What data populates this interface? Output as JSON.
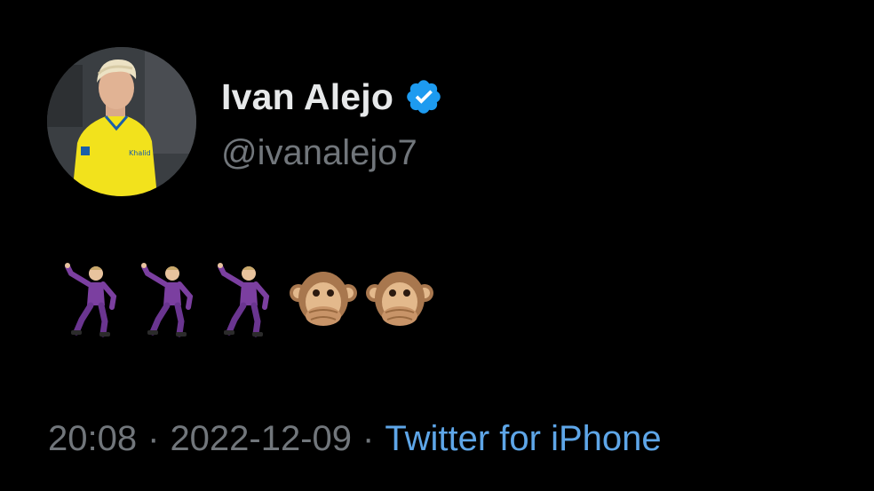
{
  "author": {
    "display_name": "Ivan Alejo",
    "handle": "@ivanalejo7",
    "verified_icon": "verified-badge",
    "avatar_icon": "profile-photo"
  },
  "tweet": {
    "emojis": [
      "man-dancing",
      "man-dancing",
      "man-dancing",
      "speak-no-evil-monkey",
      "speak-no-evil-monkey"
    ]
  },
  "meta": {
    "time": "20:08",
    "separator": "·",
    "date": "2022-12-09",
    "source": "Twitter for iPhone"
  },
  "colors": {
    "background": "#000000",
    "name_text": "#e7e9ea",
    "secondary_text": "#71767b",
    "link_blue": "#5ea6e8",
    "verified_blue": "#1d9bf0"
  }
}
